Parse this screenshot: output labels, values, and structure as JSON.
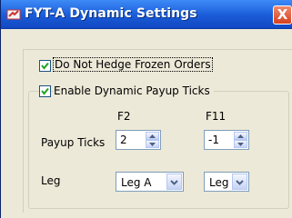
{
  "window": {
    "title": "FYT-A Dynamic Settings",
    "close_label": "X"
  },
  "options": {
    "do_not_hedge_label": "Do Not Hedge Frozen Orders",
    "do_not_hedge_checked": true,
    "enable_dynamic_label": "Enable Dynamic Payup Ticks",
    "enable_dynamic_checked": true
  },
  "grid": {
    "col1_header": "F2",
    "col2_header": "F11",
    "row_payup_label": "Payup Ticks",
    "row_leg_label": "Leg",
    "payup_f2": "2",
    "payup_f11": "-1",
    "leg_f2": "Leg A",
    "leg_f11": "Leg B"
  },
  "icons": {
    "app": "app-icon",
    "checkbox": "check-icon",
    "spin_up": "arrow-up-icon",
    "spin_down": "arrow-down-icon",
    "dropdown": "chevron-down-icon",
    "close": "close-icon"
  },
  "colors": {
    "titlebar": "#1a5bd8",
    "close_button": "#d6401f",
    "check": "#21a121",
    "dialog_bg": "#ece9d8"
  }
}
